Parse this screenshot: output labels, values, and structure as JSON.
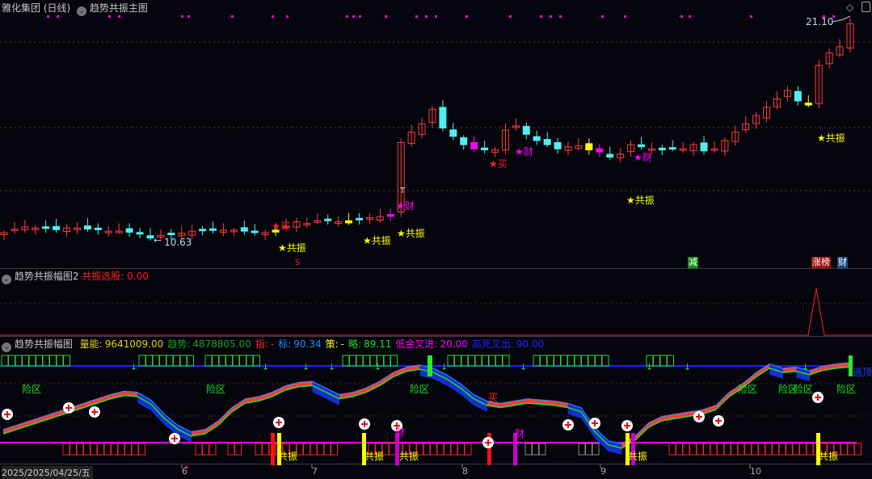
{
  "main": {
    "stock_title": "雅化集团 (日线)",
    "indicator_title": "趋势共振主图",
    "high_label": "21.10",
    "low_label": "10.63",
    "signals": {
      "resonance": "★共振",
      "buy": "★买",
      "wealth": "★财",
      "t_mark": "T",
      "s_mark": "S"
    },
    "tags": {
      "reduce": "减",
      "limit_up": "涨榜",
      "wealth": "财"
    },
    "colors": {
      "up": "#ff3b3b",
      "down": "#4ff0f0",
      "resonance": "#ffff00",
      "wealth": "#ff00ff"
    },
    "candles_close": [
      10.98,
      11.15,
      11.25,
      11.2,
      11.18,
      11.12,
      11.2,
      11.2,
      11.15,
      11.12,
      11.05,
      11.05,
      11.0,
      10.95,
      10.72,
      10.85,
      10.9,
      10.95,
      11.05,
      11.1,
      11.1,
      11.1,
      11.1,
      11.05,
      11.0,
      10.98,
      11.1,
      11.3,
      11.5,
      11.42,
      11.55,
      11.6,
      11.5,
      11.55,
      11.6,
      11.7,
      11.75,
      11.85,
      15.3,
      15.8,
      16.2,
      16.9,
      16.0,
      15.6,
      15.2,
      15.0,
      14.95,
      14.95,
      15.9,
      16.1,
      15.7,
      15.4,
      15.2,
      15.0,
      15.1,
      15.15,
      14.95,
      14.85,
      14.6,
      14.75,
      15.2,
      15.1,
      15.0,
      14.95,
      15.05,
      15.0,
      15.2,
      14.9,
      15.0,
      15.4,
      15.8,
      16.2,
      16.6,
      17.0,
      17.4,
      17.8,
      17.3,
      17.1,
      19.0,
      19.6,
      19.9,
      21.0
    ]
  },
  "panel2": {
    "title": "趋势共振幅图2",
    "label": "共振选股:",
    "value": "0.00"
  },
  "panel3": {
    "title": "趋势共振幅图",
    "fields": [
      {
        "label": "量能:",
        "value": "9641009.00",
        "color": "#e6d200"
      },
      {
        "label": "趋势:",
        "value": "4878805.00",
        "color": "#1aa01a"
      },
      {
        "label": "指:",
        "value": "-",
        "color": "#ff2020"
      },
      {
        "label": "标:",
        "value": "90.34",
        "color": "#1e90ff"
      },
      {
        "label": "策:",
        "value": "-",
        "color": "#ffff00"
      },
      {
        "label": "略:",
        "value": "89.11",
        "color": "#22dd22"
      },
      {
        "label": "低金叉进:",
        "value": "20.00",
        "color": "#ff00ff"
      },
      {
        "label": "高死叉出:",
        "value": "90.00",
        "color": "#2020ff"
      }
    ],
    "zone_label": "险区",
    "buy_label": "买",
    "wealth_label": "财",
    "resonance_label": "共振",
    "top_label": "逃顶",
    "trend": [
      28,
      32,
      36,
      40,
      44,
      48,
      52,
      56,
      60,
      63,
      62,
      55,
      42,
      32,
      26,
      28,
      36,
      48,
      56,
      58,
      62,
      68,
      71,
      72,
      66,
      60,
      62,
      66,
      72,
      80,
      85,
      87,
      84,
      78,
      70,
      60,
      54,
      52,
      54,
      56,
      55,
      54,
      52,
      48,
      30,
      18,
      15,
      22,
      34,
      40,
      42,
      44,
      46,
      50,
      62,
      70,
      80,
      88,
      84,
      85,
      82,
      86,
      88,
      89
    ]
  },
  "time_axis": {
    "start": "2025/2025/04/25/五",
    "months": [
      "6",
      "7",
      "8",
      "9",
      "10"
    ]
  }
}
